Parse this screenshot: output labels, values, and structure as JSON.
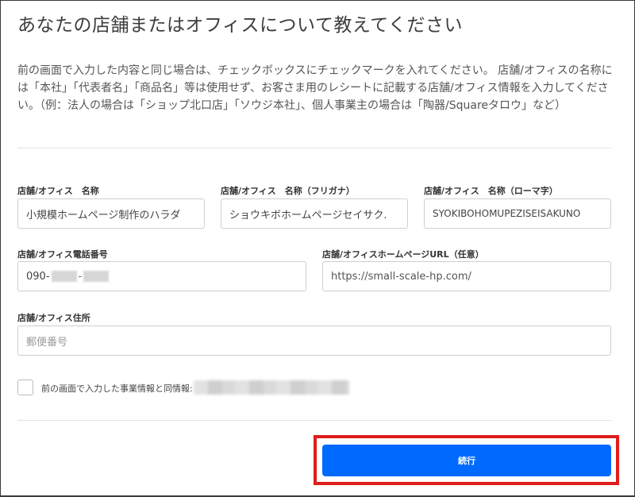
{
  "title": "あなたの店舗またはオフィスについて教えてください",
  "description": "前の画面で入力した内容と同じ場合は、チェックボックスにチェックマークを入れてください。 店舗/オフィスの名称には「本社」「代表者名」「商品名」等は使用せず、お客さま用のレシートに記載する店舗/オフィス情報を入力してください。（例：法人の場合は「ショップ北口店」「ソウジ本社」、個人事業主の場合は「陶器/Squareタロウ」など）",
  "fields": {
    "store_name": {
      "label": "店舗/オフィス　名称",
      "value": "小規模ホームページ制作のハラダ"
    },
    "store_name_kana": {
      "label": "店舗/オフィス　名称（フリガナ）",
      "value": "ショウキボホームページセイサク."
    },
    "store_name_roman": {
      "label": "店舗/オフィス　名称（ローマ字）",
      "value": "SYOKIBOHOMUPEZISEISAKUNO"
    },
    "phone": {
      "label": "店舗/オフィス電話番号",
      "value_prefix": "090-"
    },
    "homepage": {
      "label": "店舗/オフィスホームページURL（任意）",
      "value": "https://small-scale-hp.com/"
    },
    "address": {
      "label": "店舗/オフィス住所",
      "placeholder": "郵便番号"
    }
  },
  "same_info_checkbox": {
    "label": "前の画面で入力した事業情報と同情報:",
    "checked": false
  },
  "continue_button": {
    "label": "続行"
  },
  "colors": {
    "primary": "#006aff",
    "highlight": "#e01c1c"
  }
}
